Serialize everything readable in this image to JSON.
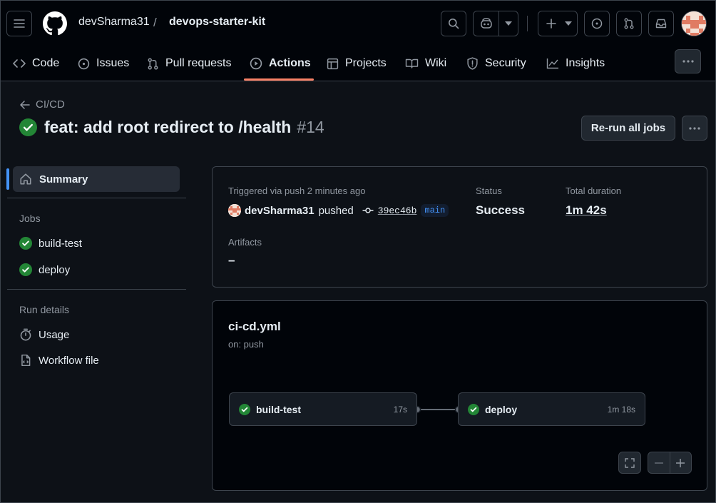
{
  "repo": {
    "owner": "devSharma31",
    "separator": "/",
    "name": "devops-starter-kit"
  },
  "nav_tabs": [
    {
      "label": "Code",
      "icon": "code-icon"
    },
    {
      "label": "Issues",
      "icon": "issue-icon"
    },
    {
      "label": "Pull requests",
      "icon": "pull-request-icon"
    },
    {
      "label": "Actions",
      "icon": "play-icon",
      "active": true
    },
    {
      "label": "Projects",
      "icon": "table-icon"
    },
    {
      "label": "Wiki",
      "icon": "book-icon"
    },
    {
      "label": "Security",
      "icon": "shield-icon"
    },
    {
      "label": "Insights",
      "icon": "graph-icon"
    }
  ],
  "run": {
    "back_label": "CI/CD",
    "title": "feat: add root redirect to /health",
    "number": "#14",
    "rerun_label": "Re-run all jobs"
  },
  "sidebar": {
    "summary_label": "Summary",
    "jobs_heading": "Jobs",
    "jobs": [
      {
        "label": "build-test",
        "status": "success"
      },
      {
        "label": "deploy",
        "status": "success"
      }
    ],
    "run_details_heading": "Run details",
    "details": [
      {
        "label": "Usage",
        "icon": "stopwatch-icon"
      },
      {
        "label": "Workflow file",
        "icon": "file-code-icon"
      }
    ]
  },
  "summary": {
    "trigger_label": "Triggered via push 2 minutes ago",
    "actor": "devSharma31",
    "action": "pushed",
    "commit_sha": "39ec46b",
    "branch": "main",
    "status_label": "Status",
    "status_value": "Success",
    "duration_label": "Total duration",
    "duration_value": "1m 42s",
    "artifacts_label": "Artifacts",
    "artifacts_value": "–"
  },
  "workflow": {
    "file": "ci-cd.yml",
    "trigger": "on: push",
    "jobs": [
      {
        "name": "build-test",
        "duration": "17s",
        "status": "success"
      },
      {
        "name": "deploy",
        "duration": "1m 18s",
        "status": "success"
      }
    ]
  },
  "colors": {
    "accent_blue": "#4493f8",
    "success_green": "#238636",
    "active_tab_underline": "#f78166",
    "background": "#0d1117",
    "header_background": "#010409"
  }
}
